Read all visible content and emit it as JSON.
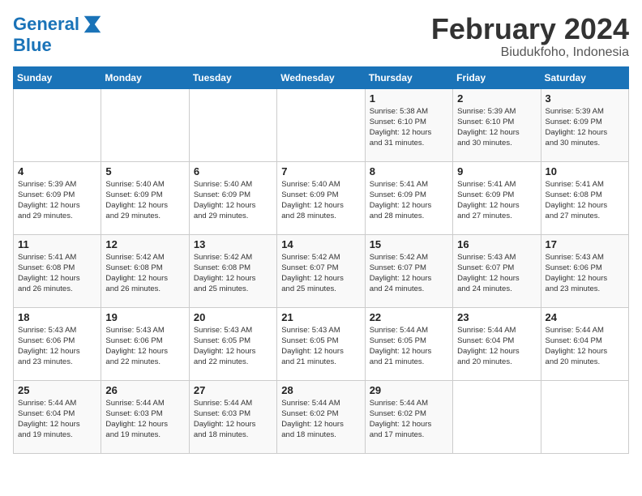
{
  "header": {
    "logo_line1": "General",
    "logo_line2": "Blue",
    "title": "February 2024",
    "subtitle": "Biudukfoho, Indonesia"
  },
  "days_of_week": [
    "Sunday",
    "Monday",
    "Tuesday",
    "Wednesday",
    "Thursday",
    "Friday",
    "Saturday"
  ],
  "weeks": [
    [
      {
        "day": "",
        "info": ""
      },
      {
        "day": "",
        "info": ""
      },
      {
        "day": "",
        "info": ""
      },
      {
        "day": "",
        "info": ""
      },
      {
        "day": "1",
        "info": "Sunrise: 5:38 AM\nSunset: 6:10 PM\nDaylight: 12 hours\nand 31 minutes."
      },
      {
        "day": "2",
        "info": "Sunrise: 5:39 AM\nSunset: 6:10 PM\nDaylight: 12 hours\nand 30 minutes."
      },
      {
        "day": "3",
        "info": "Sunrise: 5:39 AM\nSunset: 6:09 PM\nDaylight: 12 hours\nand 30 minutes."
      }
    ],
    [
      {
        "day": "4",
        "info": "Sunrise: 5:39 AM\nSunset: 6:09 PM\nDaylight: 12 hours\nand 29 minutes."
      },
      {
        "day": "5",
        "info": "Sunrise: 5:40 AM\nSunset: 6:09 PM\nDaylight: 12 hours\nand 29 minutes."
      },
      {
        "day": "6",
        "info": "Sunrise: 5:40 AM\nSunset: 6:09 PM\nDaylight: 12 hours\nand 29 minutes."
      },
      {
        "day": "7",
        "info": "Sunrise: 5:40 AM\nSunset: 6:09 PM\nDaylight: 12 hours\nand 28 minutes."
      },
      {
        "day": "8",
        "info": "Sunrise: 5:41 AM\nSunset: 6:09 PM\nDaylight: 12 hours\nand 28 minutes."
      },
      {
        "day": "9",
        "info": "Sunrise: 5:41 AM\nSunset: 6:09 PM\nDaylight: 12 hours\nand 27 minutes."
      },
      {
        "day": "10",
        "info": "Sunrise: 5:41 AM\nSunset: 6:08 PM\nDaylight: 12 hours\nand 27 minutes."
      }
    ],
    [
      {
        "day": "11",
        "info": "Sunrise: 5:41 AM\nSunset: 6:08 PM\nDaylight: 12 hours\nand 26 minutes."
      },
      {
        "day": "12",
        "info": "Sunrise: 5:42 AM\nSunset: 6:08 PM\nDaylight: 12 hours\nand 26 minutes."
      },
      {
        "day": "13",
        "info": "Sunrise: 5:42 AM\nSunset: 6:08 PM\nDaylight: 12 hours\nand 25 minutes."
      },
      {
        "day": "14",
        "info": "Sunrise: 5:42 AM\nSunset: 6:07 PM\nDaylight: 12 hours\nand 25 minutes."
      },
      {
        "day": "15",
        "info": "Sunrise: 5:42 AM\nSunset: 6:07 PM\nDaylight: 12 hours\nand 24 minutes."
      },
      {
        "day": "16",
        "info": "Sunrise: 5:43 AM\nSunset: 6:07 PM\nDaylight: 12 hours\nand 24 minutes."
      },
      {
        "day": "17",
        "info": "Sunrise: 5:43 AM\nSunset: 6:06 PM\nDaylight: 12 hours\nand 23 minutes."
      }
    ],
    [
      {
        "day": "18",
        "info": "Sunrise: 5:43 AM\nSunset: 6:06 PM\nDaylight: 12 hours\nand 23 minutes."
      },
      {
        "day": "19",
        "info": "Sunrise: 5:43 AM\nSunset: 6:06 PM\nDaylight: 12 hours\nand 22 minutes."
      },
      {
        "day": "20",
        "info": "Sunrise: 5:43 AM\nSunset: 6:05 PM\nDaylight: 12 hours\nand 22 minutes."
      },
      {
        "day": "21",
        "info": "Sunrise: 5:43 AM\nSunset: 6:05 PM\nDaylight: 12 hours\nand 21 minutes."
      },
      {
        "day": "22",
        "info": "Sunrise: 5:44 AM\nSunset: 6:05 PM\nDaylight: 12 hours\nand 21 minutes."
      },
      {
        "day": "23",
        "info": "Sunrise: 5:44 AM\nSunset: 6:04 PM\nDaylight: 12 hours\nand 20 minutes."
      },
      {
        "day": "24",
        "info": "Sunrise: 5:44 AM\nSunset: 6:04 PM\nDaylight: 12 hours\nand 20 minutes."
      }
    ],
    [
      {
        "day": "25",
        "info": "Sunrise: 5:44 AM\nSunset: 6:04 PM\nDaylight: 12 hours\nand 19 minutes."
      },
      {
        "day": "26",
        "info": "Sunrise: 5:44 AM\nSunset: 6:03 PM\nDaylight: 12 hours\nand 19 minutes."
      },
      {
        "day": "27",
        "info": "Sunrise: 5:44 AM\nSunset: 6:03 PM\nDaylight: 12 hours\nand 18 minutes."
      },
      {
        "day": "28",
        "info": "Sunrise: 5:44 AM\nSunset: 6:02 PM\nDaylight: 12 hours\nand 18 minutes."
      },
      {
        "day": "29",
        "info": "Sunrise: 5:44 AM\nSunset: 6:02 PM\nDaylight: 12 hours\nand 17 minutes."
      },
      {
        "day": "",
        "info": ""
      },
      {
        "day": "",
        "info": ""
      }
    ]
  ]
}
